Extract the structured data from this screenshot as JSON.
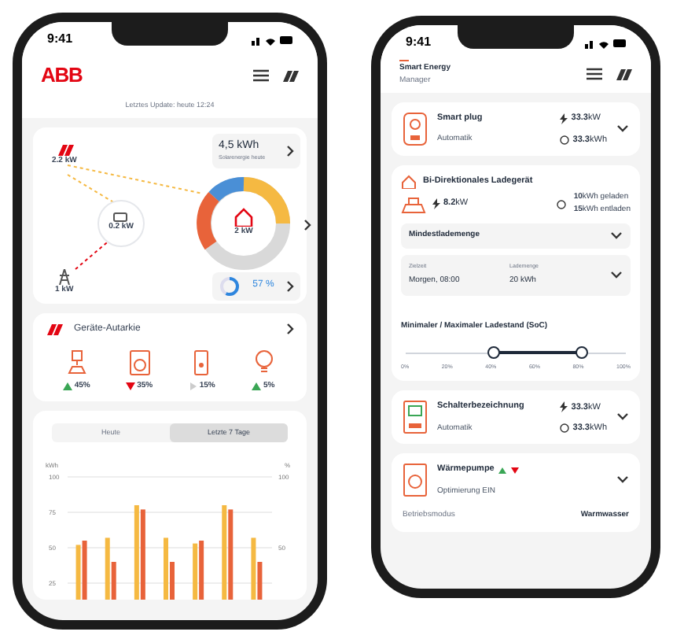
{
  "phone_left": {
    "status_time": "9:41",
    "logo": "ABB",
    "last_update": "Letztes Update: heute 12:24",
    "energy": {
      "solar": "2.2 kW",
      "battery": "0.2 kW",
      "grid": "1 kW",
      "house": "2 kW",
      "solar_today": "4,5 kWh",
      "solar_today_label": "Solarenergie heute",
      "autarky": "57 %",
      "autarky_level": {
        "level": 0.57
      }
    },
    "autarky_card": {
      "title": "Geräte-Autarkie",
      "devices": [
        {
          "kind": "charger",
          "trend": {
            "kind": "up"
          },
          "value": "45%"
        },
        {
          "kind": "washer",
          "trend": {
            "kind": "down"
          },
          "value": "35%"
        },
        {
          "kind": "boiler",
          "trend": {
            "kind": "neutral"
          },
          "value": "15%"
        },
        {
          "kind": "bulb",
          "trend": {
            "kind": "up"
          },
          "value": "5%"
        }
      ]
    },
    "chart_card": {
      "tabs": [
        {
          "label": "Heute",
          "selected": false
        },
        {
          "label": "Letzte 7 Tage",
          "selected": true
        }
      ],
      "chart_data": {
        "type": "bar",
        "ylabel": "kWh",
        "yticks": [
          25,
          50,
          75,
          100
        ],
        "ylim": [
          0,
          100
        ],
        "grid": true,
        "series": [
          {
            "color": "#f5b942",
            "values": [
              52,
              57,
              80,
              57,
              53,
              80,
              57
            ]
          },
          {
            "color": "#e8633a",
            "values": [
              55,
              40,
              77,
              40,
              55,
              77,
              40
            ]
          }
        ]
      },
      "right_axis_label": "%",
      "right_ticks": [
        "100",
        "50"
      ]
    }
  },
  "phone_right": {
    "status_time": "9:41",
    "title": "Smart Energy",
    "subtitle": "Manager",
    "smart_plug": {
      "name": "Smart plug",
      "mode": "Automatik",
      "power": "**33.3**kW",
      "energy": "**33.3**kWh"
    },
    "charger": {
      "name": "Bi-Direktionales Ladegerät",
      "power": "**8.2**kW",
      "charged": "**10**kWh geladen",
      "discharged": "**15**kWh entladen",
      "dropdown": "Mindestlademenge",
      "fields": [
        {
          "label": "Zielzeit",
          "value": "Morgen, 08:00"
        },
        {
          "label": "Lademenge",
          "value": "20 kWh"
        }
      ],
      "soc_label": "Minimaler / Maximaler Ladestand (SoC)",
      "soc_min": {
        "level": 0.4
      },
      "soc_max": {
        "level": 0.8
      },
      "ticks": [
        "0%",
        "20%",
        "40%",
        "60%",
        "80%",
        "100%"
      ]
    },
    "switch": {
      "name": "Schalterbezeichnung",
      "mode": "Automatik",
      "power": "**33.3**kW",
      "energy": "**33.3**kWh"
    },
    "heat_pump": {
      "name": "Wärmepumpe",
      "mode": "Optimierung EIN",
      "rows": [
        {
          "label": "Betriebsmodus",
          "value": "Warmwasser"
        }
      ]
    }
  }
}
